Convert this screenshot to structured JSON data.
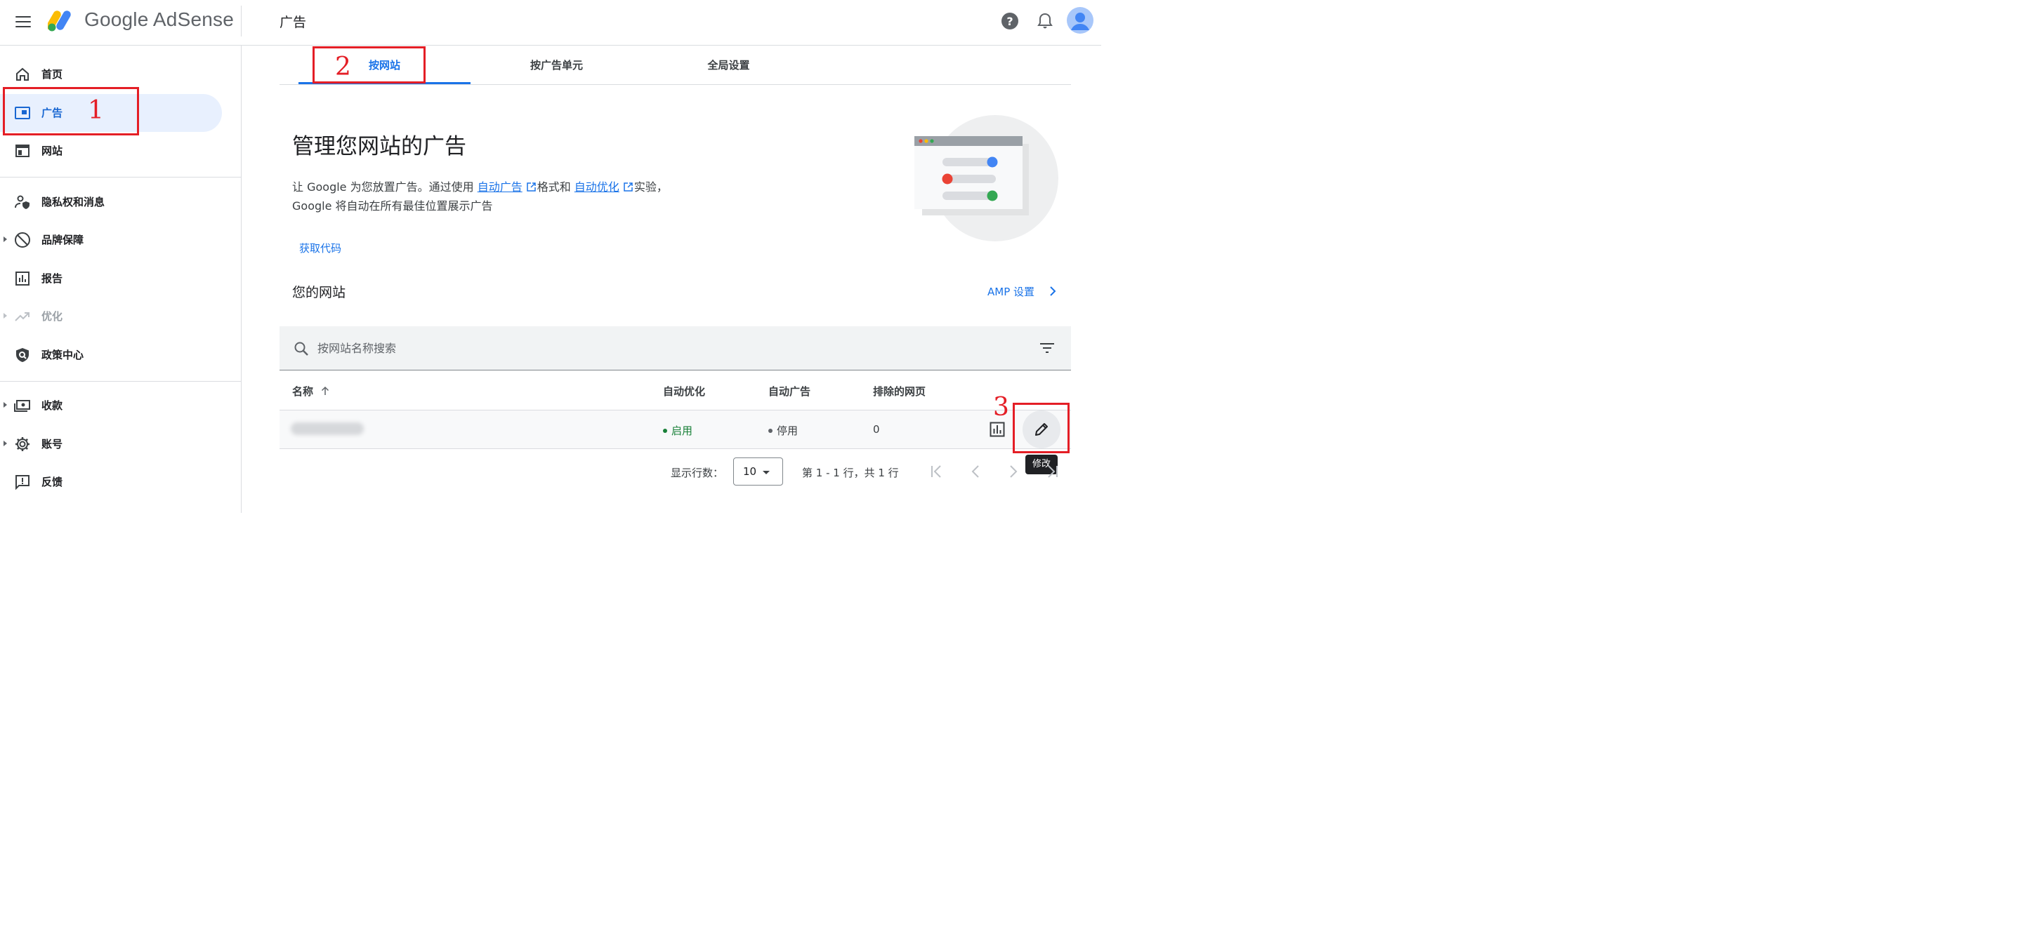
{
  "header": {
    "brand": "Google AdSense",
    "title": "广告"
  },
  "sidebar": {
    "items": [
      {
        "label": "首页"
      },
      {
        "label": "广告"
      },
      {
        "label": "网站"
      },
      {
        "label": "隐私权和消息"
      },
      {
        "label": "品牌保障"
      },
      {
        "label": "报告"
      },
      {
        "label": "优化"
      },
      {
        "label": "政策中心"
      },
      {
        "label": "收款"
      },
      {
        "label": "账号"
      },
      {
        "label": "反馈"
      }
    ]
  },
  "tabs": [
    {
      "label": "按网站"
    },
    {
      "label": "按广告单元"
    },
    {
      "label": "全局设置"
    }
  ],
  "main": {
    "heading": "管理您网站的广告",
    "desc_prefix": "让 Google 为您放置广告。通过使用 ",
    "link_auto_ads": "自动广告",
    "desc_mid": "格式和 ",
    "link_auto_opt": "自动优化",
    "desc_suffix_line1": "实验，",
    "desc_line2": "Google 将自动在所有最佳位置展示广告",
    "get_code": "获取代码",
    "your_sites": "您的网站",
    "amp_settings": "AMP 设置"
  },
  "search": {
    "placeholder": "按网站名称搜索"
  },
  "table": {
    "headers": [
      "名称",
      "自动优化",
      "自动广告",
      "排除的网页"
    ],
    "rows": [
      {
        "auto_opt": "启用",
        "auto_ads": "停用",
        "excluded": "0"
      }
    ]
  },
  "tooltip": "修改",
  "pagination": {
    "rows_label": "显示行数：",
    "rows_value": "10",
    "range": "第 1 - 1 行，共 1 行"
  },
  "annotations": [
    "1",
    "2",
    "3"
  ],
  "colors": {
    "accent": "#1a73e8",
    "active_bg": "#e8f0fe",
    "enabled_green": "#188038",
    "annotation_red": "#e41e26"
  }
}
